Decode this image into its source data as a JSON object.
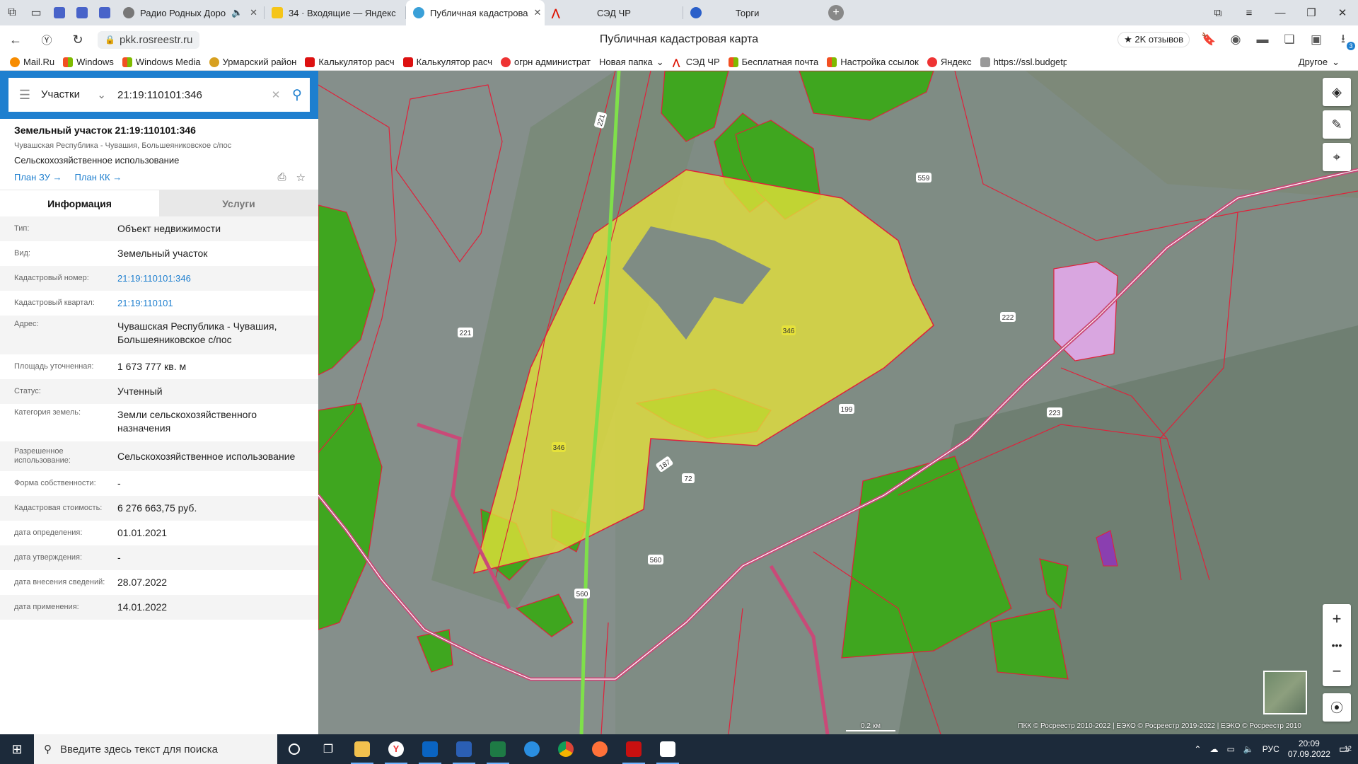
{
  "browser": {
    "tabs": [
      {
        "label": "Радио Родных Доро",
        "muted_icon": "🔈"
      },
      {
        "label": "34 · Входящие — Яндекс"
      },
      {
        "label": "Публичная кадастрова"
      },
      {
        "label": "СЭД ЧР"
      },
      {
        "label": "Торги"
      }
    ],
    "url": "pkk.rosreestr.ru",
    "page_title": "Публичная кадастровая карта",
    "reviews": "2K отзывов",
    "bookmarks": [
      "Mail.Ru",
      "Windows",
      "Windows Media",
      "Урмарский район",
      "Калькулятор расч",
      "Калькулятор расч",
      "огрн администрат",
      "Новая папка",
      "СЭД ЧР",
      "Бесплатная почта",
      "Настройка ссылок",
      "Яндекс",
      "https://ssl.budgetp"
    ],
    "bookmarks_other": "Другое",
    "download_badge": "3"
  },
  "search": {
    "category": "Участки",
    "query": "21:19:110101:346"
  },
  "object": {
    "title": "Земельный участок 21:19:110101:346",
    "subtitle": "Чувашская Республика - Чувашия, Большеяниковское с/пос",
    "use": "Сельскохозяйственное использование",
    "link_plan_zu": "План ЗУ →",
    "link_plan_kk": "План КК →"
  },
  "tabs": {
    "info": "Информация",
    "services": "Услуги"
  },
  "info_rows": [
    {
      "key": "Тип:",
      "value": "Объект недвижимости"
    },
    {
      "key": "Вид:",
      "value": "Земельный участок"
    },
    {
      "key": "Кадастровый номер:",
      "value": "21:19:110101:346"
    },
    {
      "key": "Кадастровый квартал:",
      "value": "21:19:110101"
    },
    {
      "key": "Адрес:",
      "value": "Чувашская Республика - Чувашия, Большеяниковское с/пос"
    },
    {
      "key": "Площадь уточненная:",
      "value": "1 673 777 кв. м"
    },
    {
      "key": "Статус:",
      "value": "Учтенный"
    },
    {
      "key": "Категория земель:",
      "value": "Земли сельскохозяйственного назначения"
    },
    {
      "key": "Разрешенное использование:",
      "value": "Сельскохозяйственное использование"
    },
    {
      "key": "Форма собственности:",
      "value": "-"
    },
    {
      "key": "Кадастровая стоимость:",
      "value": "6 276 663,75 руб."
    },
    {
      "key": "дата определения:",
      "value": "01.01.2021"
    },
    {
      "key": "дата утверждения:",
      "value": "-"
    },
    {
      "key": "дата внесения сведений:",
      "value": "28.07.2022"
    },
    {
      "key": "дата применения:",
      "value": "14.01.2022"
    }
  ],
  "map": {
    "parcel_labels": [
      "346",
      "346",
      "221",
      "221",
      "559",
      "222",
      "199",
      "223",
      "187",
      "72",
      "560",
      "560"
    ],
    "scale": "0.2 км",
    "copyright": "ПКК © Росреестр 2010-2022 | ЕЭКО © Росреестр 2019-2022 | ЕЭКО © Росреестр 2010",
    "colors": {
      "selected": "#e6e23a",
      "agri": "#3fa61f",
      "boundary": "#e0213a",
      "road": "#c94a78",
      "other": "#d9a6e0"
    }
  },
  "taskbar": {
    "search_placeholder": "Введите здесь текст для поиска",
    "lang": "РУС",
    "time": "20:09",
    "date": "07.09.2022",
    "notif": "12"
  }
}
